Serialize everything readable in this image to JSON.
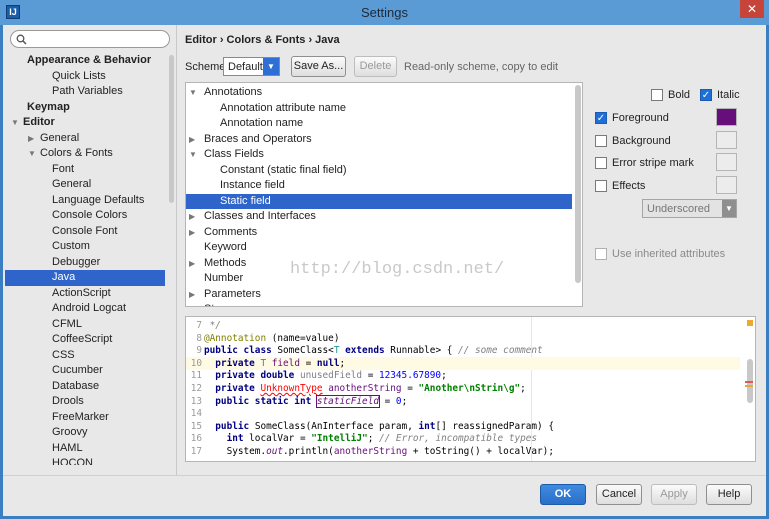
{
  "window": {
    "title": "Settings",
    "app_icon": "IJ",
    "close_glyph": "✕"
  },
  "search": {
    "placeholder": ""
  },
  "sidebar": {
    "items": [
      {
        "label": "Appearance & Behavior",
        "level": 1,
        "bold": true
      },
      {
        "label": "Quick Lists",
        "level": 2
      },
      {
        "label": "Path Variables",
        "level": 2
      },
      {
        "label": "Keymap",
        "level": 1,
        "bold": true
      },
      {
        "label": "Editor",
        "level": 0,
        "bold": true,
        "arrow": "down"
      },
      {
        "label": "General",
        "level": 1,
        "arrow": "right"
      },
      {
        "label": "Colors & Fonts",
        "level": 1,
        "arrow": "down"
      },
      {
        "label": "Font",
        "level": 2
      },
      {
        "label": "General",
        "level": 2
      },
      {
        "label": "Language Defaults",
        "level": 2
      },
      {
        "label": "Console Colors",
        "level": 2
      },
      {
        "label": "Console Font",
        "level": 2
      },
      {
        "label": "Custom",
        "level": 2
      },
      {
        "label": "Debugger",
        "level": 2
      },
      {
        "label": "Java",
        "level": 2,
        "selected": true
      },
      {
        "label": "ActionScript",
        "level": 2
      },
      {
        "label": "Android Logcat",
        "level": 2
      },
      {
        "label": "CFML",
        "level": 2
      },
      {
        "label": "CoffeeScript",
        "level": 2
      },
      {
        "label": "CSS",
        "level": 2
      },
      {
        "label": "Cucumber",
        "level": 2
      },
      {
        "label": "Database",
        "level": 2
      },
      {
        "label": "Drools",
        "level": 2
      },
      {
        "label": "FreeMarker",
        "level": 2
      },
      {
        "label": "Groovy",
        "level": 2
      },
      {
        "label": "HAML",
        "level": 2
      },
      {
        "label": "HOCON",
        "level": 2
      }
    ]
  },
  "breadcrumb": "Editor › Colors & Fonts › Java",
  "scheme": {
    "label": "Scheme:",
    "value": "Default",
    "save_as_label": "Save As...",
    "delete_label": "Delete",
    "readonly_note": "Read-only scheme, copy to edit"
  },
  "elements": [
    {
      "label": "Annotations",
      "indent": 0,
      "arrow": "down"
    },
    {
      "label": "Annotation attribute name",
      "indent": 1
    },
    {
      "label": "Annotation name",
      "indent": 1
    },
    {
      "label": "Braces and Operators",
      "indent": 0,
      "arrow": "right"
    },
    {
      "label": "Class Fields",
      "indent": 0,
      "arrow": "down"
    },
    {
      "label": "Constant (static final field)",
      "indent": 1
    },
    {
      "label": "Instance field",
      "indent": 1
    },
    {
      "label": "Static field",
      "indent": 1,
      "selected": true
    },
    {
      "label": "Classes and Interfaces",
      "indent": 0,
      "arrow": "right"
    },
    {
      "label": "Comments",
      "indent": 0,
      "arrow": "right"
    },
    {
      "label": "Keyword",
      "indent": 0
    },
    {
      "label": "Methods",
      "indent": 0,
      "arrow": "right"
    },
    {
      "label": "Number",
      "indent": 0
    },
    {
      "label": "Parameters",
      "indent": 0,
      "arrow": "right"
    },
    {
      "label": "Str...",
      "indent": 0,
      "arrow": "right"
    }
  ],
  "watermark": "http://blog.csdn.net/",
  "attributes": {
    "bold": {
      "label": "Bold",
      "checked": false
    },
    "italic": {
      "label": "Italic",
      "checked": true
    },
    "foreground": {
      "label": "Foreground",
      "checked": true,
      "color": "#660e7a"
    },
    "background": {
      "label": "Background",
      "checked": false
    },
    "error_stripe": {
      "label": "Error stripe mark",
      "checked": false
    },
    "effects": {
      "label": "Effects",
      "checked": false
    },
    "effects_type": "Underscored",
    "use_inherited": {
      "label": "Use inherited attributes",
      "checked": false
    }
  },
  "colors": {
    "accent": "#2f65ca",
    "primary_button": "#2a6fc8",
    "static_field": "#660e7a",
    "keyword": "#000080",
    "string": "#008000",
    "comment": "#808080"
  },
  "preview": {
    "lines": [
      {
        "n": "7",
        "segs": [
          {
            "t": " */",
            "c": "cm"
          }
        ]
      },
      {
        "n": "8",
        "segs": [
          {
            "t": "@Annotation",
            "c": "an"
          },
          {
            "t": " (name=value)",
            "c": "pl"
          }
        ]
      },
      {
        "n": "9",
        "segs": [
          {
            "t": "public class ",
            "c": "kw"
          },
          {
            "t": "SomeClass<",
            "c": "pl"
          },
          {
            "t": "T",
            "c": "tp"
          },
          {
            "t": " extends ",
            "c": "kw"
          },
          {
            "t": "Runnable> { ",
            "c": "pl"
          },
          {
            "t": "// some comment",
            "c": "cm"
          }
        ]
      },
      {
        "n": "10",
        "hl": true,
        "segs": [
          {
            "t": "  private ",
            "c": "kw"
          },
          {
            "t": "T",
            "c": "tp"
          },
          {
            "t": " field",
            "c": "fld"
          },
          {
            "t": " = ",
            "c": "pl"
          },
          {
            "t": "null",
            "c": "kw"
          },
          {
            "t": ";",
            "c": "pl"
          }
        ]
      },
      {
        "n": "11",
        "segs": [
          {
            "t": "  private double ",
            "c": "kw"
          },
          {
            "t": "unusedField",
            "c": "unused"
          },
          {
            "t": " = ",
            "c": "pl"
          },
          {
            "t": "12345.67890",
            "c": "num"
          },
          {
            "t": ";",
            "c": "pl"
          }
        ]
      },
      {
        "n": "12",
        "segs": [
          {
            "t": "  private ",
            "c": "kw"
          },
          {
            "t": "UnknownType",
            "c": "err"
          },
          {
            "t": " anotherString",
            "c": "fld"
          },
          {
            "t": " = ",
            "c": "pl"
          },
          {
            "t": "\"Another\\nStrin\\g\"",
            "c": "str"
          },
          {
            "t": ";",
            "c": "pl"
          }
        ]
      },
      {
        "n": "13",
        "segs": [
          {
            "t": "  public static int ",
            "c": "kw"
          },
          {
            "t": "staticField",
            "c": "fldi"
          },
          {
            "t": " = ",
            "c": "pl"
          },
          {
            "t": "0",
            "c": "num"
          },
          {
            "t": ";",
            "c": "pl"
          }
        ]
      },
      {
        "n": "14",
        "segs": []
      },
      {
        "n": "15",
        "segs": [
          {
            "t": "  public ",
            "c": "kw"
          },
          {
            "t": "SomeClass(AnInterface param, ",
            "c": "pl"
          },
          {
            "t": "int",
            "c": "kw"
          },
          {
            "t": "[] reassignedParam) {",
            "c": "pl"
          }
        ]
      },
      {
        "n": "16",
        "segs": [
          {
            "t": "    ",
            "c": "pl"
          },
          {
            "t": "int",
            "c": "kw"
          },
          {
            "t": " localVar = ",
            "c": "pl"
          },
          {
            "t": "\"IntelliJ\"",
            "c": "str"
          },
          {
            "t": "; ",
            "c": "pl"
          },
          {
            "t": "// Error, incompatible types",
            "c": "cm"
          }
        ]
      },
      {
        "n": "17",
        "segs": [
          {
            "t": "    System.",
            "c": "pl"
          },
          {
            "t": "out",
            "c": "fldi"
          },
          {
            "t": ".println(",
            "c": "pl"
          },
          {
            "t": "anotherString",
            "c": "fld"
          },
          {
            "t": " + toString() + localVar);",
            "c": "pl"
          }
        ]
      }
    ]
  },
  "footer": {
    "ok_label": "OK",
    "cancel_label": "Cancel",
    "apply_label": "Apply",
    "help_label": "Help"
  }
}
